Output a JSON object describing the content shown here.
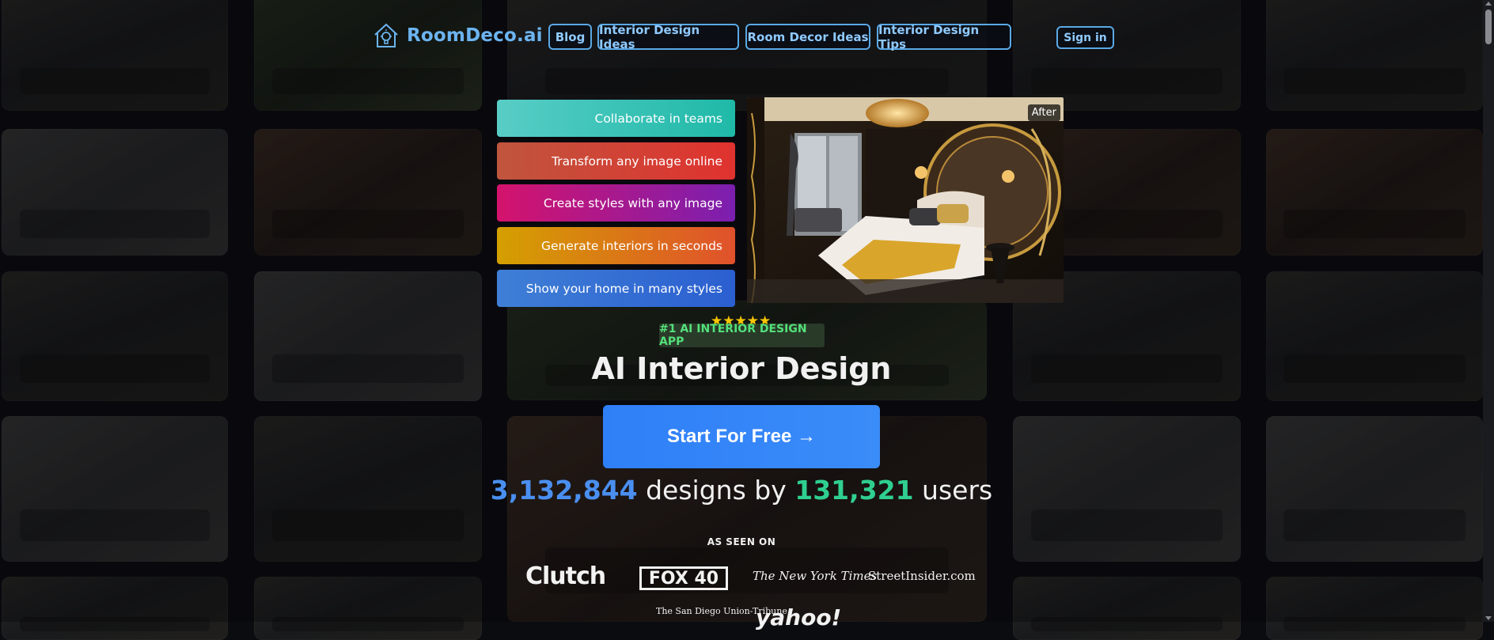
{
  "header": {
    "brand": "RoomDeco.ai",
    "nav": [
      "Blog",
      "Interior Design Ideas",
      "Room Decor Ideas",
      "Interior Design Tips"
    ],
    "signin": "Sign in"
  },
  "features": [
    {
      "label": "Collaborate in teams",
      "from": "#58cdc6",
      "to": "#1fb9a8"
    },
    {
      "label": "Transform any image online",
      "from": "#c0553d",
      "to": "#e0322f"
    },
    {
      "label": "Create styles with any image",
      "from": "#d4136c",
      "to": "#7b1fb0"
    },
    {
      "label": "Generate interiors in seconds",
      "from": "#d4a000",
      "to": "#e0512c"
    },
    {
      "label": "Show your home in many styles",
      "from": "#3f7fd6",
      "to": "#2b5fd0"
    }
  ],
  "preview": {
    "badge": "After"
  },
  "hero": {
    "stars": "★★★★★",
    "badge": "#1 AI INTERIOR DESIGN APP",
    "title": "AI Interior Design",
    "cta": "Start For Free →",
    "designs_count": "3,132,844",
    "designs_text": "designs by",
    "users_count": "131,321",
    "users_text": "users"
  },
  "press": {
    "heading": "AS SEEN ON",
    "logos": [
      "Clutch",
      "FOX 40",
      "The New York Times",
      "StreetInsider.com",
      "The San Diego Union-Tribune",
      "yahoo!"
    ]
  },
  "colors": {
    "brand": "#6cb4f0",
    "nav_border": "#5aa9e6",
    "cta": "#2f7ff7",
    "stat_blue": "#4a8ff0",
    "stat_green": "#2fcf8f",
    "badge_green": "#53e07a"
  }
}
